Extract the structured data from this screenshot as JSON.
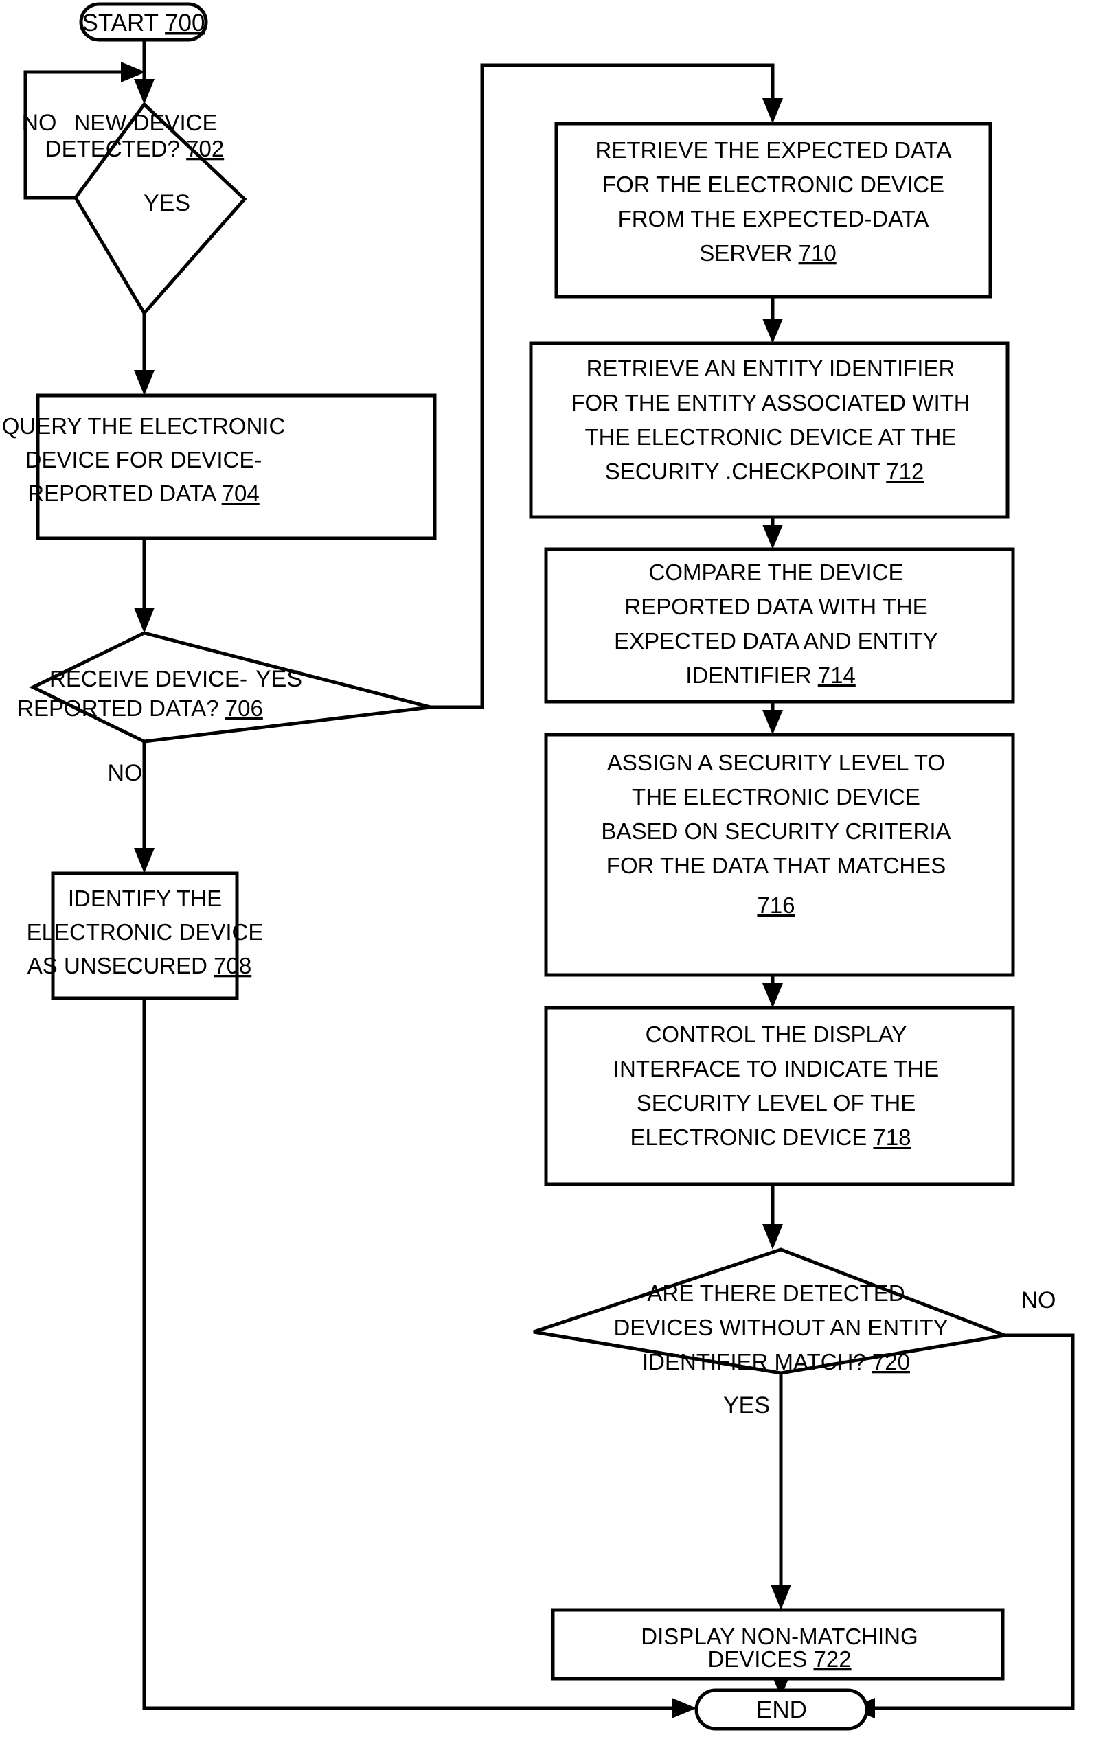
{
  "figure": {
    "type": "flowchart",
    "orientation": "two-column, top-to-bottom",
    "nodes": {
      "start": {
        "kind": "terminator",
        "label": "START",
        "ref": "700"
      },
      "d702": {
        "kind": "decision",
        "lines": [
          "NEW DEVICE",
          "DETECTED?"
        ],
        "ref": "702",
        "branches": {
          "no": "NO",
          "yes": "YES"
        }
      },
      "p704": {
        "kind": "process",
        "lines": [
          "QUERY THE ELECTRONIC",
          "DEVICE FOR DEVICE-",
          "REPORTED DATA"
        ],
        "ref": "704"
      },
      "d706": {
        "kind": "decision",
        "lines": [
          "RECEIVE DEVICE-",
          "REPORTED DATA?"
        ],
        "ref": "706",
        "branches": {
          "yes": "YES",
          "no": "NO"
        }
      },
      "p708": {
        "kind": "process",
        "lines": [
          "IDENTIFY THE",
          "ELECTRONIC DEVICE",
          "AS UNSECURED"
        ],
        "ref": "708"
      },
      "p710": {
        "kind": "process",
        "lines": [
          "RETRIEVE THE EXPECTED DATA",
          "FOR THE ELECTRONIC DEVICE",
          "FROM THE EXPECTED-DATA",
          "SERVER"
        ],
        "ref": "710"
      },
      "p712": {
        "kind": "process",
        "lines": [
          "RETRIEVE AN ENTITY IDENTIFIER",
          "FOR THE ENTITY ASSOCIATED WITH",
          "THE ELECTRONIC DEVICE AT THE",
          "SECURITY .CHECKPOINT"
        ],
        "ref": "712"
      },
      "p714": {
        "kind": "process",
        "lines": [
          "COMPARE THE DEVICE",
          "REPORTED DATA WITH THE",
          "EXPECTED DATA AND ENTITY",
          "IDENTIFIER"
        ],
        "ref": "714"
      },
      "p716": {
        "kind": "process",
        "lines": [
          "ASSIGN A SECURITY LEVEL TO",
          "THE ELECTRONIC DEVICE",
          "BASED ON SECURITY CRITERIA",
          "FOR THE DATA THAT MATCHES"
        ],
        "ref": "716",
        "ref_on_own_line": true
      },
      "p718": {
        "kind": "process",
        "lines": [
          "CONTROL THE DISPLAY",
          "INTERFACE TO INDICATE THE",
          "SECURITY LEVEL OF THE",
          "ELECTRONIC DEVICE"
        ],
        "ref": "718"
      },
      "d720": {
        "kind": "decision",
        "lines": [
          "ARE THERE DETECTED",
          "DEVICES WITHOUT AN ENTITY",
          "IDENTIFIER MATCH?"
        ],
        "ref": "720",
        "branches": {
          "no": "NO",
          "yes": "YES"
        }
      },
      "p722": {
        "kind": "process",
        "lines": [
          "DISPLAY NON-MATCHING",
          "DEVICES"
        ],
        "ref": "722"
      },
      "end": {
        "kind": "terminator",
        "label": "END",
        "ref": ""
      }
    },
    "edges": [
      {
        "from": "start",
        "to": "d702",
        "label": ""
      },
      {
        "from": "d702",
        "to": "d702",
        "label": "NO",
        "note": "loop back to input of 702"
      },
      {
        "from": "d702",
        "to": "p704",
        "label": "YES"
      },
      {
        "from": "p704",
        "to": "d706",
        "label": ""
      },
      {
        "from": "d706",
        "to": "p710",
        "label": "YES"
      },
      {
        "from": "d706",
        "to": "p708",
        "label": "NO"
      },
      {
        "from": "p708",
        "to": "end",
        "label": ""
      },
      {
        "from": "p710",
        "to": "p712",
        "label": ""
      },
      {
        "from": "p712",
        "to": "p714",
        "label": ""
      },
      {
        "from": "p714",
        "to": "p716",
        "label": ""
      },
      {
        "from": "p716",
        "to": "p718",
        "label": ""
      },
      {
        "from": "p718",
        "to": "d720",
        "label": ""
      },
      {
        "from": "d720",
        "to": "p722",
        "label": "YES"
      },
      {
        "from": "d720",
        "to": "end",
        "label": "NO"
      },
      {
        "from": "p722",
        "to": "end",
        "label": ""
      }
    ],
    "colors": {
      "stroke": "#000000",
      "fill": "#ffffff",
      "text": "#000000"
    }
  }
}
